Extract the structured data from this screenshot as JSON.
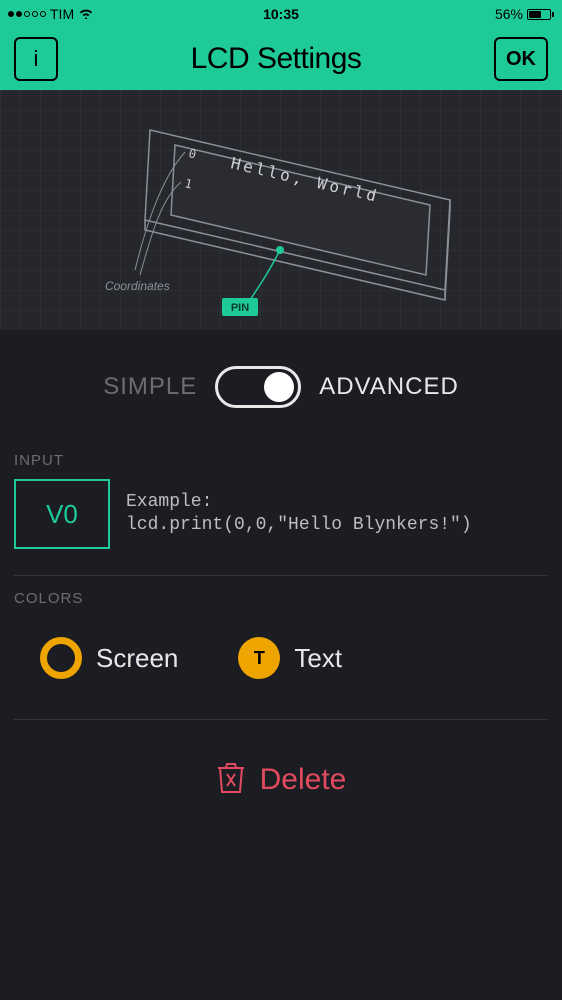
{
  "status": {
    "carrier": "TIM",
    "time": "10:35",
    "battery_pct": "56%"
  },
  "header": {
    "title": "LCD Settings",
    "info_label": "i",
    "ok_label": "OK"
  },
  "diagram": {
    "coordinates_label": "Coordinates",
    "pin_label": "PIN",
    "lcd_text": "Hello, World",
    "row0": "0",
    "row1": "1"
  },
  "toggle": {
    "simple_label": "SIMPLE",
    "advanced_label": "ADVANCED",
    "state": "advanced"
  },
  "sections": {
    "input_label": "INPUT",
    "colors_label": "COLORS"
  },
  "input": {
    "pin": "V0",
    "example_line1": "Example:",
    "example_line2": "lcd.print(0,0,\"Hello Blynkers!\")"
  },
  "colors": {
    "screen_label": "Screen",
    "text_label": "Text",
    "text_icon_letter": "T",
    "accent": "#efa500"
  },
  "delete": {
    "label": "Delete"
  }
}
